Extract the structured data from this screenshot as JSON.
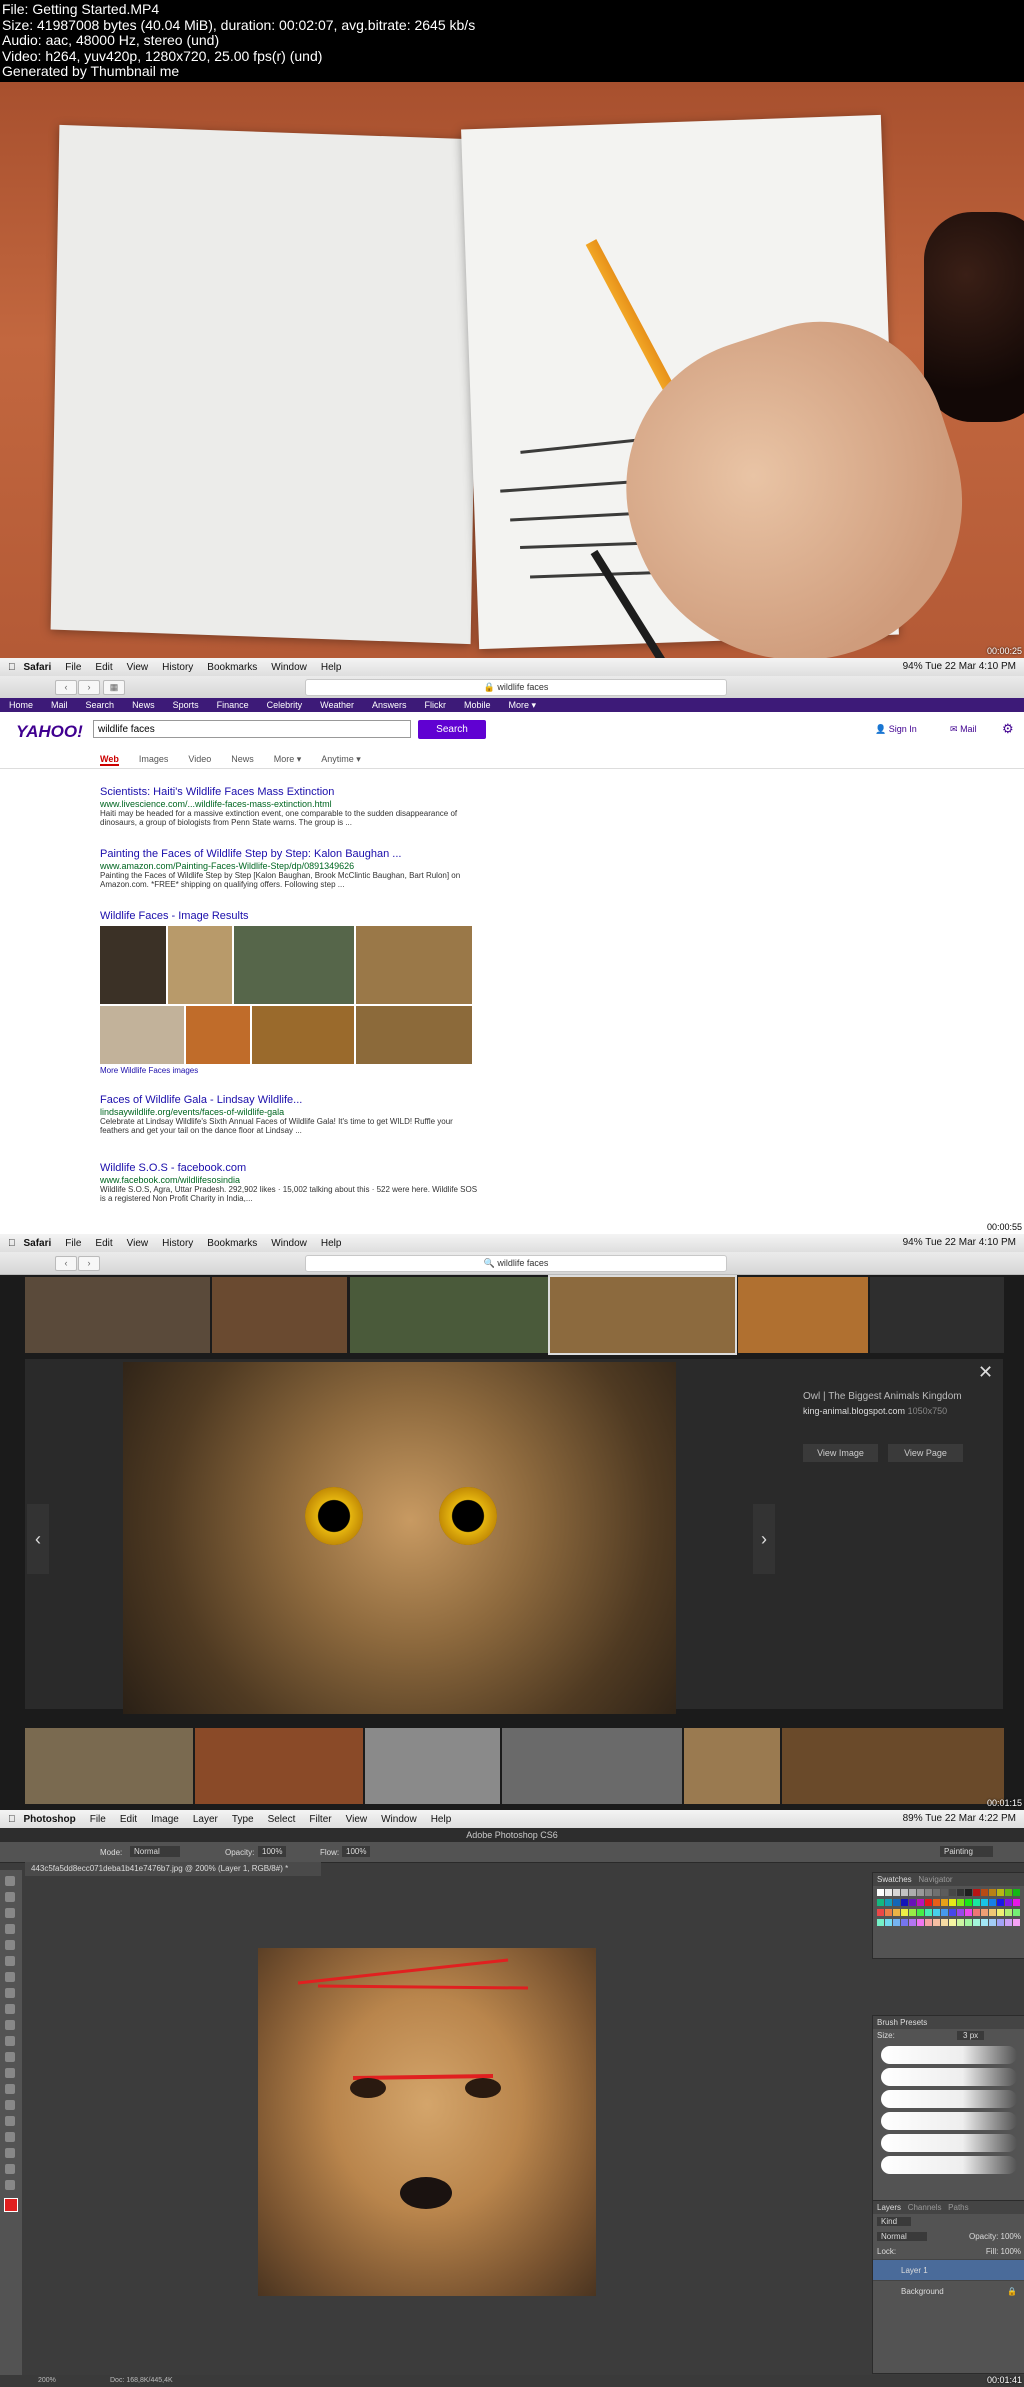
{
  "header": {
    "line1": "File: Getting Started.MP4",
    "line2": "Size: 41987008 bytes (40.04 MiB), duration: 00:02:07, avg.bitrate: 2645 kb/s",
    "line3": "Audio: aac, 48000 Hz, stereo (und)",
    "line4": "Video: h264, yuv420p, 1280x720, 25.00 fps(r) (und)",
    "line5": "Generated by Thumbnail me"
  },
  "timestamps": [
    "00:00:25",
    "00:00:55",
    "00:01:15",
    "00:01:41"
  ],
  "safari": {
    "menu": [
      "Safari",
      "File",
      "Edit",
      "View",
      "History",
      "Bookmarks",
      "Window",
      "Help"
    ],
    "status_p2": "94%  Tue 22 Mar  4:10 PM",
    "status_p3": "94%  Tue 22 Mar  4:10 PM",
    "url": "wildlife faces"
  },
  "yahoo": {
    "nav": [
      "Home",
      "Mail",
      "Search",
      "News",
      "Sports",
      "Finance",
      "Celebrity",
      "Weather",
      "Answers",
      "Flickr",
      "Mobile",
      "More ▾"
    ],
    "logo": "YAHOO!",
    "query": "wildlife faces",
    "search_btn": "Search",
    "sign_in": "Sign In",
    "mail": "Mail",
    "tabs": [
      "Web",
      "Images",
      "Video",
      "News",
      "More ▾",
      "Anytime ▾"
    ],
    "results": [
      {
        "title": "Scientists: Haiti's Wildlife Faces Mass Extinction",
        "url": "www.livescience.com/...wildlife-faces-mass-extinction.html",
        "snippet": "Haiti may be headed for a massive extinction event, one comparable to the sudden disappearance of dinosaurs, a group of biologists from Penn State warns. The group is ..."
      },
      {
        "title": "Painting the Faces of Wildlife Step by Step: Kalon Baughan ...",
        "url": "www.amazon.com/Painting-Faces-Wildlife-Step/dp/0891349626",
        "snippet": "Painting the Faces of Wildlife Step by Step [Kalon Baughan, Brook McClintic Baughan, Bart Rulon] on Amazon.com. *FREE* shipping on qualifying offers. Following step ..."
      }
    ],
    "image_results_title": "Wildlife Faces - Image Results",
    "more_images": "More Wildlife Faces images",
    "results2": [
      {
        "title": "Faces of Wildlife Gala - Lindsay Wildlife...",
        "url": "lindsaywildlife.org/events/faces-of-wildlife-gala",
        "snippet": "Celebrate at Lindsay Wildlife's Sixth Annual Faces of Wildlife Gala! It's time to get WILD! Ruffle your feathers and get your tail on the dance floor at Lindsay ..."
      },
      {
        "title": "Wildlife S.O.S - facebook.com",
        "url": "www.facebook.com/wildlifesosindia",
        "snippet": "Wildlife S.O.S, Agra, Uttar Pradesh. 292,902 likes · 15,002 talking about this · 522 were here. Wildlife SOS is a registered Non Profit Charity in India,..."
      }
    ]
  },
  "viewer": {
    "caption_title": "Owl | The Biggest Animals Kingdom",
    "caption_site": "king-animal.blogspot.com",
    "caption_size": "1050x750",
    "view_image": "View Image",
    "view_page": "View Page"
  },
  "photoshop": {
    "menu": [
      "Photoshop",
      "File",
      "Edit",
      "Image",
      "Layer",
      "Type",
      "Select",
      "Filter",
      "View",
      "Window",
      "Help"
    ],
    "status": "89%  Tue 22 Mar  4:22 PM",
    "title": "Adobe Photoshop CS6",
    "doc_tab": "443c5fa5dd8ecc071deba1b41e7476b7.jpg @ 200% (Layer 1, RGB/8#) *",
    "opts": {
      "mode_label": "Mode:",
      "mode": "Normal",
      "opacity_label": "Opacity:",
      "opacity": "100%",
      "flow_label": "Flow:",
      "flow": "100%",
      "workspace": "Painting"
    },
    "swatches_tab": "Swatches",
    "navigator_tab": "Navigator",
    "brush_presets": "Brush Presets",
    "size_label": "Size:",
    "size_value": "3 px",
    "layers_tabs": [
      "Layers",
      "Channels",
      "Paths"
    ],
    "kind": "Kind",
    "blend": "Normal",
    "opacity_l": "Opacity: 100%",
    "lock": "Lock:",
    "fill": "Fill: 100%",
    "layers": [
      "Layer 1",
      "Background"
    ],
    "zoom": "200%",
    "doc": "Doc: 168,8K/445,4K"
  },
  "colors": {
    "yahoo_purple": "#400090",
    "search_btn": "#6001d2",
    "link": "#1a0dab",
    "url_green": "#006621",
    "annotation_red": "#e02020"
  }
}
